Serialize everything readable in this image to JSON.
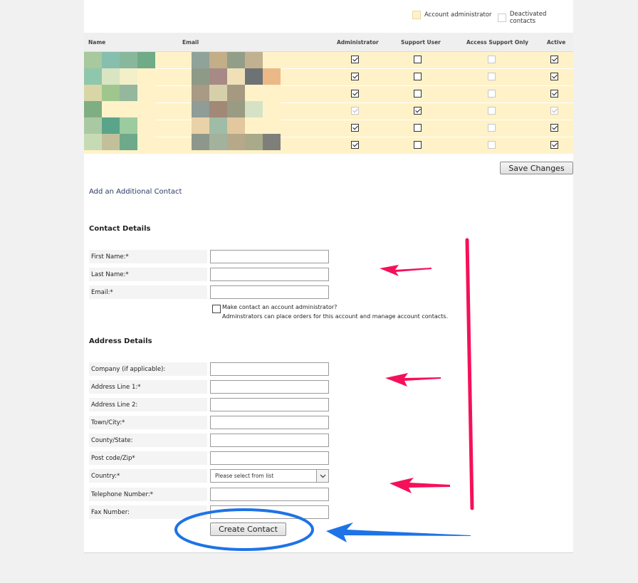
{
  "legend": {
    "admin_label": "Account administrator",
    "deactivated_label": "Deactivated contacts"
  },
  "table": {
    "headers": {
      "name": "Name",
      "email": "Email",
      "administrator": "Administrator",
      "support_user": "Support User",
      "access_support_only": "Access Support Only",
      "active": "Active"
    },
    "rows": [
      {
        "administrator": true,
        "support_user": false,
        "access_support_only": false,
        "active": true,
        "disabled": false
      },
      {
        "administrator": true,
        "support_user": false,
        "access_support_only": false,
        "active": true,
        "disabled": false
      },
      {
        "administrator": true,
        "support_user": false,
        "access_support_only": false,
        "active": true,
        "disabled": false
      },
      {
        "administrator": true,
        "support_user": true,
        "access_support_only": false,
        "active": true,
        "disabled": true
      },
      {
        "administrator": true,
        "support_user": false,
        "access_support_only": false,
        "active": true,
        "disabled": false
      },
      {
        "administrator": true,
        "support_user": false,
        "access_support_only": false,
        "active": true,
        "disabled": false
      }
    ]
  },
  "save_button": "Save Changes",
  "add_contact_link": "Add an Additional Contact",
  "contact_details": {
    "title": "Contact Details",
    "first_name": "First Name:*",
    "last_name": "Last Name:*",
    "email": "Email:*",
    "admin_checkbox_label": "Make contact an account administrator?",
    "admin_checkbox_help": "Adminstrators can place orders for this account and manage account contacts."
  },
  "address_details": {
    "title": "Address Details",
    "company": "Company (if applicable):",
    "address1": "Address Line 1:*",
    "address2": "Address Line 2:",
    "town": "Town/City:*",
    "county": "County/State:",
    "postcode": "Post code/Zip*",
    "country": "Country:*",
    "country_select": "Please select from list",
    "telephone": "Telephone Number:*",
    "fax": "Fax Number:"
  },
  "create_button": "Create Contact",
  "colors": {
    "row_highlight": "#fff2c8",
    "annotation_pink": "#f5105a",
    "annotation_blue": "#1e73e6"
  }
}
